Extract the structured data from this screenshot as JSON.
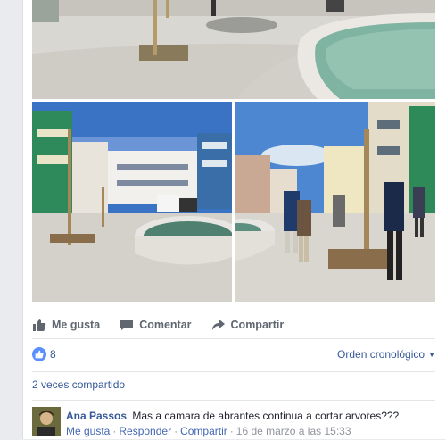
{
  "post": {
    "actions": {
      "like_label": "Me gusta",
      "comment_label": "Comentar",
      "share_label": "Compartir"
    },
    "reactions": {
      "like_count": "8",
      "order_label": "Orden cronológico"
    },
    "shares_label": "2 veces compartido"
  },
  "comment": {
    "author": "Ana Passos",
    "text": "Mas a camara de abrantes continua a cortar arvores???",
    "like_label": "Me gusta",
    "reply_label": "Responder",
    "share_label": "Compartir",
    "timestamp": "16 de marzo a las 15:33"
  },
  "icons": {
    "like": "thumbs-up-icon",
    "comment": "speech-bubble-icon",
    "share": "share-arrow-icon",
    "like_badge": "like-badge-icon",
    "order_caret": "caret-down-icon"
  },
  "colors": {
    "link": "#365899",
    "action_text": "#606770",
    "like_badge": "#5890ff",
    "page_bg": "#e9ebee"
  }
}
